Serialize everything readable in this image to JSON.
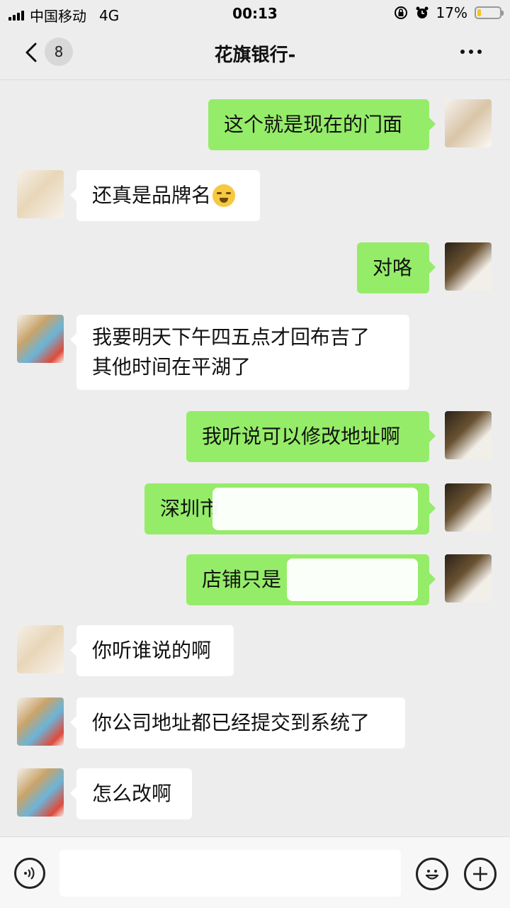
{
  "status_bar": {
    "carrier": "中国移动",
    "network": "4G",
    "time": "00:13",
    "battery_percent": "17%",
    "battery_level": 0.17
  },
  "header": {
    "unread_count": "8",
    "title": "花旗银行-"
  },
  "messages": [
    {
      "side": "right",
      "text": "这个就是现在的门面"
    },
    {
      "side": "left",
      "text": "还真是品牌名",
      "emoji": "facepalm-emoji"
    },
    {
      "side": "right",
      "text": "对咯"
    },
    {
      "side": "left",
      "lines": [
        "我要明天下午四五点才回布吉了",
        "其他时间在平湖了"
      ]
    },
    {
      "side": "right",
      "text": "我听说可以修改地址啊"
    },
    {
      "side": "right",
      "text": "深圳市",
      "redacted": true
    },
    {
      "side": "right",
      "text": "店铺只是",
      "redacted": true
    },
    {
      "side": "left",
      "text": "你听谁说的啊"
    },
    {
      "side": "left",
      "text": "你公司地址都已经提交到系统了"
    },
    {
      "side": "left",
      "text": "怎么改啊"
    }
  ],
  "input_bar": {
    "icons": [
      "voice-icon",
      "emoji-icon",
      "plus-icon"
    ],
    "text": ""
  },
  "colors": {
    "background": "#ededed",
    "sent_bubble": "#95ec69",
    "received_bubble": "#ffffff"
  }
}
